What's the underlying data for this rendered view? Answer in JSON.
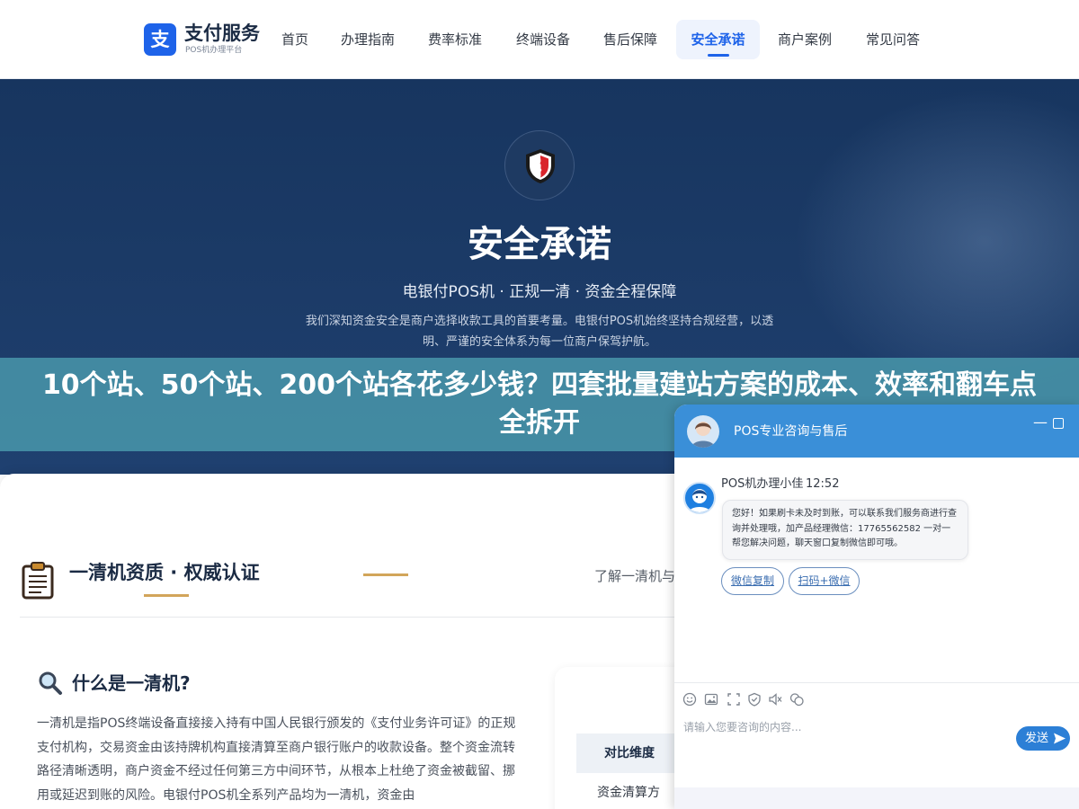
{
  "brand": {
    "logo_char": "支",
    "name": "支付服务",
    "sub": "POS机办理平台",
    "accent": "#1e63e9"
  },
  "nav": {
    "items": [
      {
        "label": "首页"
      },
      {
        "label": "办理指南"
      },
      {
        "label": "费率标准"
      },
      {
        "label": "终端设备"
      },
      {
        "label": "售后保障"
      },
      {
        "label": "安全承诺",
        "active": true
      },
      {
        "label": "商户案例"
      },
      {
        "label": "常见问答"
      }
    ]
  },
  "hero": {
    "icon": "shield-icon",
    "title": "安全承诺",
    "subtitle": "电银付POS机 · 正规一清 · 资金全程保障",
    "desc_line1": "我们深知资金安全是商户选择收款工具的首要考量。电银付POS机始终坚持合规经营，以透",
    "desc_line2": "明、严谨的安全体系为每一位商户保驾护航。"
  },
  "banner": {
    "title": "10个站、50个站、200个站各花多少钱？四套批量建站方案的成本、效率和翻车点全拆开"
  },
  "section": {
    "icon": "clipboard-icon",
    "title": "一清机资质 · 权威认证",
    "link": "了解一清机与",
    "question_icon": "magnifier-icon",
    "question": "什么是一清机?",
    "body": "一清机是指POS终端设备直接接入持有中国人民银行颁发的《支付业务许可证》的正规支付机构，交易资金由该持牌机构直接清算至商户银行账户的收款设备。整个资金流转路径清晰透明，商户资金不经过任何第三方中间环节，从根本上杜绝了资金被截留、挪用或延迟到账的风险。电银付POS机全系列产品均为一清机，资金由",
    "compare_header": "对比维度",
    "compare_row1": "资金清算方"
  },
  "chat": {
    "header_title": "POS专业咨询与售后",
    "agent_name": "POS机办理小佳",
    "time": "12:52",
    "message": "您好！如果刷卡未及时到账，可以联系我们服务商进行查询并处理哦，加产品经理微信：17765562582 一对一帮您解决问题，聊天窗口复制微信即可哦。",
    "chips": [
      "微信复制",
      "扫码+微信"
    ],
    "toolbar_icons": [
      "emoji-icon",
      "image-icon",
      "screenshot-icon",
      "rating-icon",
      "voice-icon",
      "chat-history-icon"
    ],
    "input_placeholder": "请输入您要咨询的内容...",
    "send_label": "发送",
    "header_color": "#3a8fd8"
  }
}
